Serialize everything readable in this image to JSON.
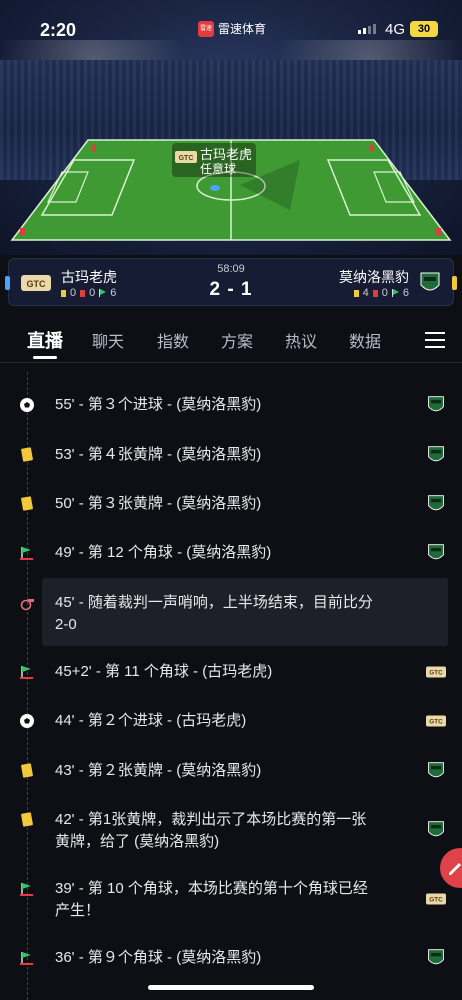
{
  "status_bar": {
    "time": "2:20",
    "app_name": "雷速体育",
    "network": "4G",
    "battery": "30"
  },
  "pitch": {
    "team_label": "古玛老虎",
    "event_label": "任意球",
    "ad_text": "雷速体育"
  },
  "match": {
    "home": {
      "name": "古玛老虎",
      "yellow": "0",
      "red": "0",
      "corners": "6",
      "logo_text": "GTC"
    },
    "away": {
      "name": "莫纳洛黑豹",
      "yellow": "4",
      "red": "0",
      "corners": "6"
    },
    "time": "58:09",
    "score": "2 - 1"
  },
  "tabs": [
    {
      "label": "直播",
      "active": true
    },
    {
      "label": "聊天"
    },
    {
      "label": "指数"
    },
    {
      "label": "方案"
    },
    {
      "label": "热议"
    },
    {
      "label": "数据"
    }
  ],
  "events": [
    {
      "icon": "soccer-ball-icon",
      "text": "55' - 第３个进球 - (莫纳洛黑豹)",
      "team": "away"
    },
    {
      "icon": "yellow-card-icon",
      "text": "53' - 第４张黄牌 - (莫纳洛黑豹)",
      "team": "away"
    },
    {
      "icon": "yellow-card-icon",
      "text": "50' - 第３张黄牌 - (莫纳洛黑豹)",
      "team": "away"
    },
    {
      "icon": "corner-flag-icon",
      "text": "49' - 第 12 个角球 - (莫纳洛黑豹)",
      "team": "away"
    },
    {
      "icon": "whistle-icon",
      "line1": "45' - 随着裁判一声哨响，上半场结束，目前比分",
      "line2": "2-0"
    },
    {
      "icon": "corner-flag-icon",
      "text": "45+2' - 第 11 个角球 - (古玛老虎)",
      "team": "home"
    },
    {
      "icon": "soccer-ball-icon",
      "text": "44' - 第２个进球 - (古玛老虎)",
      "team": "home"
    },
    {
      "icon": "yellow-card-icon",
      "text": "43' - 第２张黄牌 - (莫纳洛黑豹)",
      "team": "away"
    },
    {
      "icon": "yellow-card-icon",
      "line1": "42' - 第1张黄牌，裁判出示了本场比赛的第一张",
      "line2": "黄牌，给了 (莫纳洛黑豹)",
      "team": "away"
    },
    {
      "icon": "corner-flag-icon",
      "line1": "39' - 第 10 个角球，本场比赛的第十个角球已经",
      "line2": "产生！",
      "team": "home"
    },
    {
      "icon": "corner-flag-icon",
      "text": "36' - 第９个角球 - (莫纳洛黑豹)",
      "team": "away"
    }
  ],
  "colors": {
    "background": "#0d0f14",
    "yellow_card": "#f3c93c",
    "corner_flag": "#35c46a",
    "pitch": "#3f9a34"
  }
}
